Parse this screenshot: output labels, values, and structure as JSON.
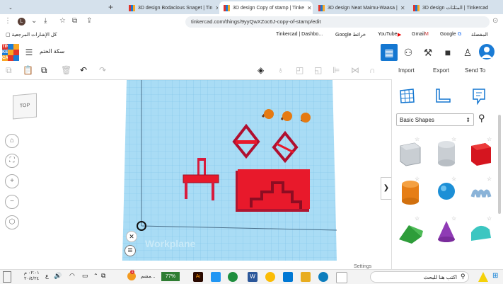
{
  "tabs": [
    {
      "label": "3D design Bodacious Snaget | Tin",
      "active": false
    },
    {
      "label": "3D design Copy of stamp | Tinke",
      "active": true
    },
    {
      "label": "3D design Neat Maimu-Waasa |",
      "active": false
    },
    {
      "label": "3D design المثلثات | Tinkercad",
      "active": false
    }
  ],
  "window": {
    "minimize": "—",
    "chevron": "⌄"
  },
  "profile_initial": "L",
  "address": {
    "url": "tinkercad.com/things/9yyQwXZoc6J-copy-of-stamp/edit"
  },
  "bookmarks": {
    "all": "كل الإشارات المرجعية",
    "items": [
      "Tinkercad | Dashbo...",
      "Google خرائط",
      "YouTube",
      "Gmail",
      "Google",
      "المفضلة"
    ]
  },
  "header": {
    "logo": [
      "TIN",
      "KER",
      "CAD"
    ],
    "design_name": "سكة الختم"
  },
  "toolbar": {
    "import": "Import",
    "export": "Export",
    "send_to": "Send To"
  },
  "workspace": {
    "view_cube": "TOP",
    "workplane_label": "Workplane",
    "settings": "Settings"
  },
  "panel": {
    "category": "Basic Shapes"
  },
  "taskbar": {
    "time": "٠٢:٠١ م",
    "date": "٢٠/٤/٢٤",
    "lang": "ع",
    "battery": "77%",
    "notification": "مشم...",
    "badge": "1",
    "search_placeholder": "اكتب هنا للبحث"
  },
  "colors": {
    "accent": "#1477d1",
    "shape_red": "#e8192b",
    "grid": "#a9dcf5"
  }
}
